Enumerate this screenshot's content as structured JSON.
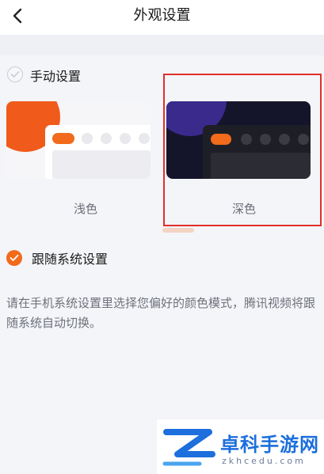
{
  "header": {
    "title": "外观设置"
  },
  "manual_section": {
    "label": "手动设置",
    "selected": false
  },
  "themes": [
    {
      "name": "浅色"
    },
    {
      "name": "深色"
    }
  ],
  "follow_section": {
    "label": "跟随系统设置",
    "selected": true
  },
  "description": "请在手机系统设置里选择您偏好的颜色模式，腾讯视频将跟随系统自动切换。",
  "watermark": {
    "title": "卓科手游网",
    "subtitle": "zkhcedu.com"
  },
  "colors": {
    "accent": "#f26a1b",
    "highlight": "#e0302b",
    "dark_card_bg": "#14152a",
    "light_card_bg": "#f6f6f8"
  }
}
